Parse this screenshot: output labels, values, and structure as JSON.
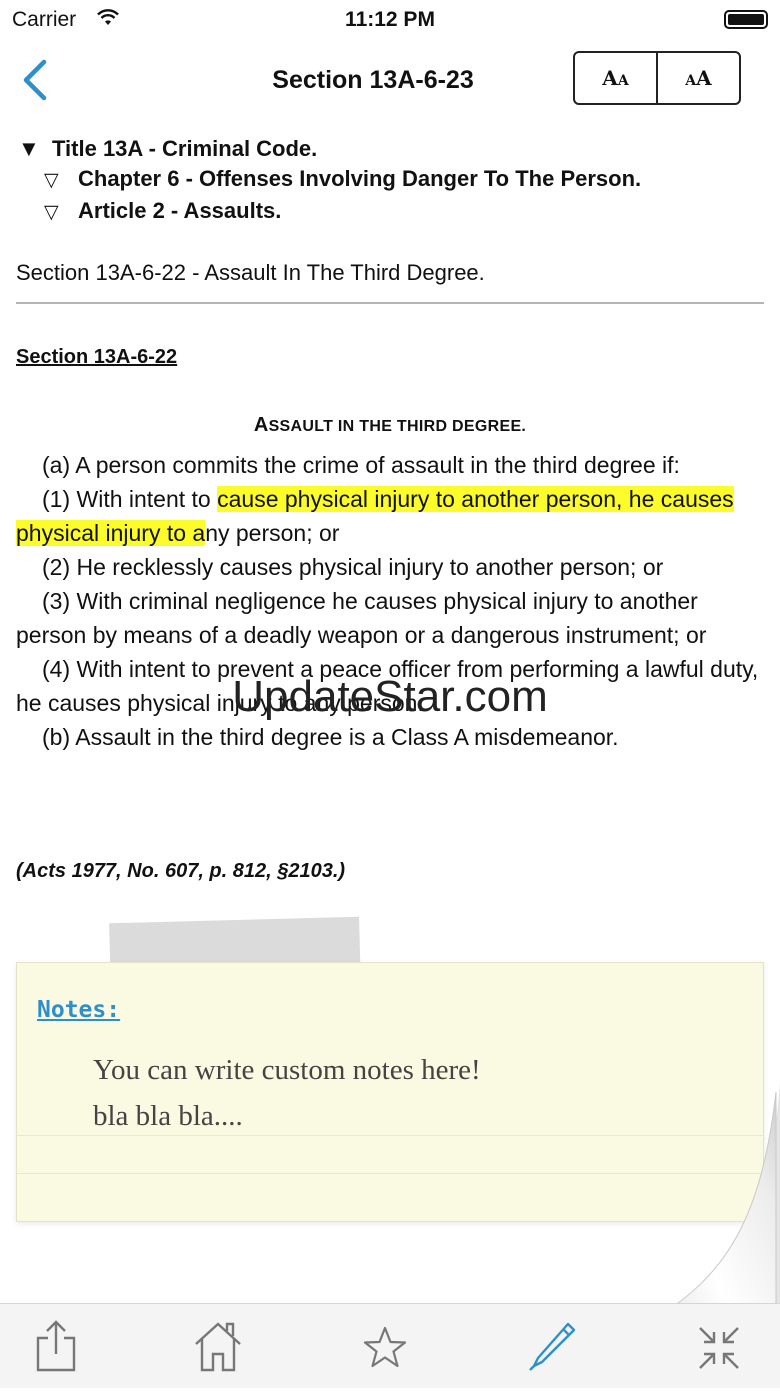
{
  "status_bar": {
    "carrier": "Carrier",
    "time": "11:12 PM"
  },
  "nav": {
    "title": "Section 13A-6-23",
    "font_decrease_glyph": "A",
    "font_increase_glyph": "A"
  },
  "breadcrumb": {
    "title": "Title 13A - Criminal Code.",
    "chapter": "Chapter 6 - Offenses Involving Danger To The Person.",
    "article": "Article 2 - Assaults."
  },
  "related_section": "Section 13A-6-22 - Assault In The Third Degree.",
  "section": {
    "heading": "Section 13A-6-22",
    "subtitle_first": "A",
    "subtitle_rest": "SSAULT IN THE THIRD DEGREE.",
    "para_a": "(a) A person commits the crime of assault in the third degree if:",
    "item1_start": "(1) With intent to ",
    "item1_highlight": "cause physical injury to another person, he causes physical injury to a",
    "item1_end": "ny person; or",
    "item2": "(2) He recklessly causes physical injury to another person; or",
    "item3": "(3) With criminal negligence he causes physical injury to another person by means of a deadly weapon or a dangerous instrument; or",
    "item4": "(4) With intent to prevent a peace officer from performing a lawful duty, he causes physical injury to any person.",
    "para_b": "(b) Assault in the third degree is a Class A misdemeanor.",
    "citation": "(Acts 1977, No. 607, p. 812, §2103.)"
  },
  "watermark": "UpdateStar.com",
  "notes": {
    "label": "Notes:",
    "line1": "You can write custom notes here!",
    "line2": "bla bla bla...."
  },
  "colors": {
    "accent": "#2f8fc9",
    "highlight": "#fcfc2a",
    "note_background": "#fafae2"
  },
  "toolbar": {
    "icons": [
      "share-icon",
      "home-icon",
      "star-icon",
      "pen-icon",
      "collapse-icon"
    ]
  }
}
